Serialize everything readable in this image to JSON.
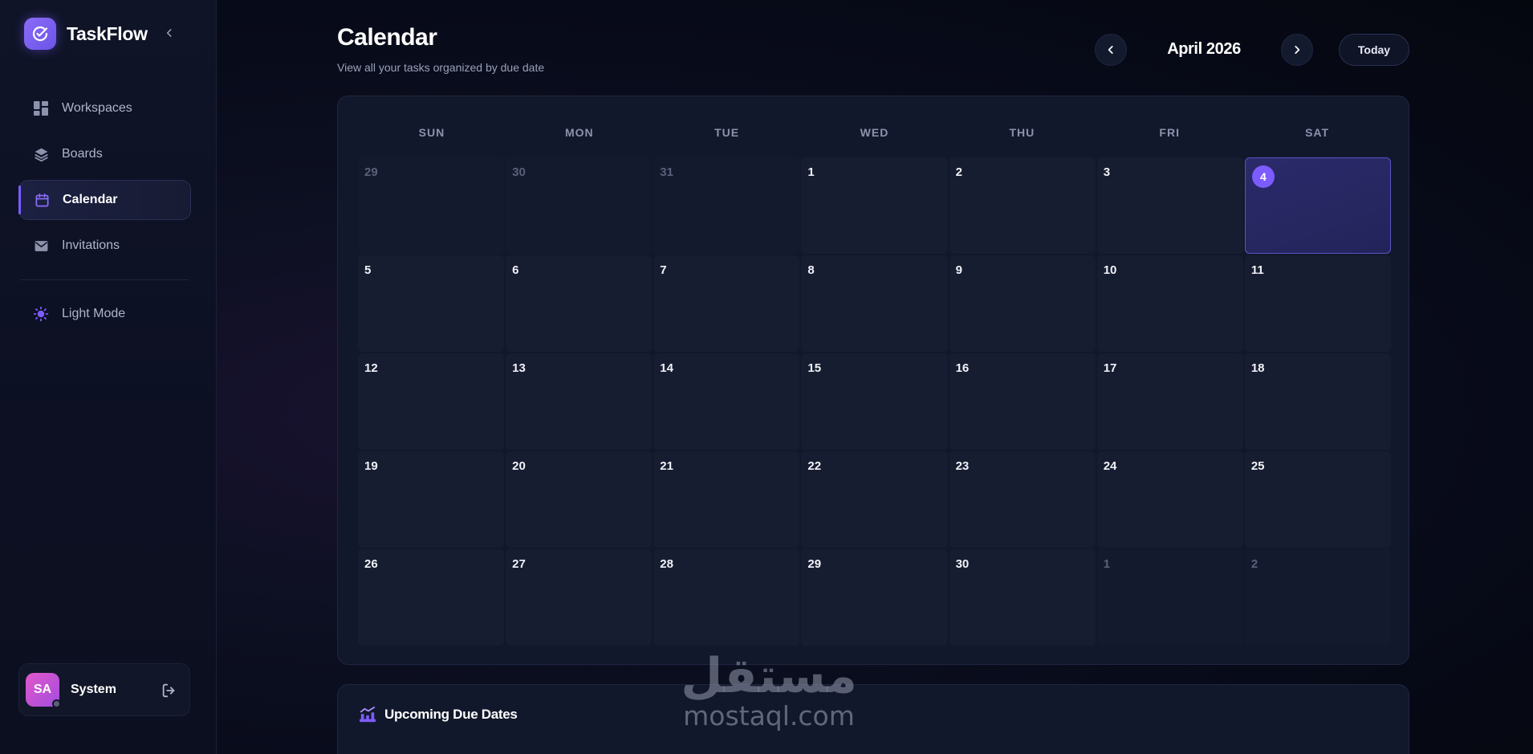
{
  "brand": {
    "name": "TaskFlow"
  },
  "sidebar": {
    "items": [
      {
        "label": "Workspaces",
        "icon": "grid-icon"
      },
      {
        "label": "Boards",
        "icon": "layers-icon"
      },
      {
        "label": "Calendar",
        "icon": "calendar-icon",
        "active": true
      },
      {
        "label": "Invitations",
        "icon": "mail-icon"
      }
    ],
    "theme_toggle": "Light Mode"
  },
  "user": {
    "initials": "SA",
    "name": "System"
  },
  "header": {
    "title": "Calendar",
    "subtitle": "View all your tasks organized by due date",
    "month": "April 2026",
    "today_label": "Today"
  },
  "calendar": {
    "weekdays": [
      "SUN",
      "MON",
      "TUE",
      "WED",
      "THU",
      "FRI",
      "SAT"
    ],
    "today_day": "4",
    "days": [
      {
        "n": "29",
        "muted": true
      },
      {
        "n": "30",
        "muted": true
      },
      {
        "n": "31",
        "muted": true
      },
      {
        "n": "1"
      },
      {
        "n": "2"
      },
      {
        "n": "3"
      },
      {
        "n": "4",
        "today": true
      },
      {
        "n": "5"
      },
      {
        "n": "6"
      },
      {
        "n": "7"
      },
      {
        "n": "8"
      },
      {
        "n": "9"
      },
      {
        "n": "10"
      },
      {
        "n": "11"
      },
      {
        "n": "12"
      },
      {
        "n": "13"
      },
      {
        "n": "14"
      },
      {
        "n": "15"
      },
      {
        "n": "16"
      },
      {
        "n": "17"
      },
      {
        "n": "18"
      },
      {
        "n": "19"
      },
      {
        "n": "20"
      },
      {
        "n": "21"
      },
      {
        "n": "22"
      },
      {
        "n": "23"
      },
      {
        "n": "24"
      },
      {
        "n": "25"
      },
      {
        "n": "26"
      },
      {
        "n": "27"
      },
      {
        "n": "28"
      },
      {
        "n": "29"
      },
      {
        "n": "30"
      },
      {
        "n": "1",
        "muted": true
      },
      {
        "n": "2",
        "muted": true
      }
    ]
  },
  "upcoming": {
    "title": "Upcoming Due Dates"
  },
  "watermark": {
    "arabic": "مستقل",
    "latin": "mostaql.com"
  },
  "colors": {
    "accent": "#7c5cff",
    "background": "#070a18",
    "panel": "#12182b"
  }
}
